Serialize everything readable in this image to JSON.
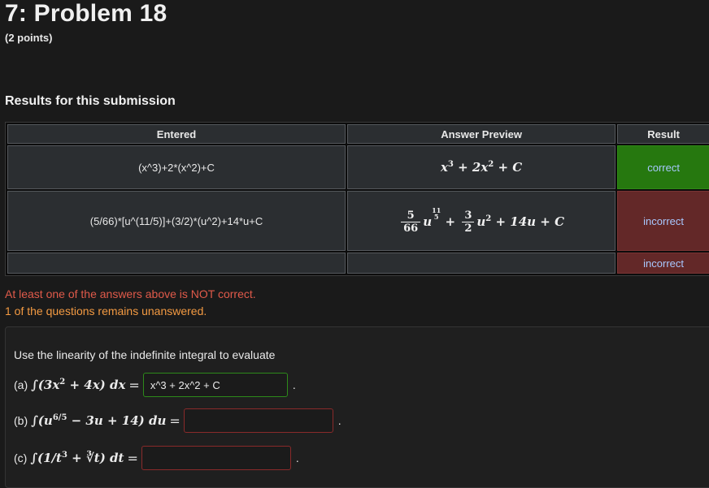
{
  "header": {
    "title": "7: Problem 18",
    "points": "(2 points)"
  },
  "results": {
    "heading": "Results for this submission",
    "columns": [
      "Entered",
      "Answer Preview",
      "Result"
    ],
    "rows": [
      {
        "entered": "(x^3)+2*(x^2)+C",
        "result": "correct"
      },
      {
        "entered": "(5/66)*[u^(11/5)]+(3/2)*(u^2)+14*u+C",
        "result": "incorrect"
      },
      {
        "entered": "",
        "result": "incorrect"
      }
    ],
    "preview1": {
      "a": "x",
      "e1": "3",
      "plus1": "+ 2",
      "b": "x",
      "e2": "2",
      "tail": "+ C"
    },
    "preview2": {
      "num1": "5",
      "den1": "66",
      "u1": "u",
      "en": "11",
      "ed": "5",
      "plus1": "+",
      "num2": "3",
      "den2": "2",
      "u2": "u",
      "e2": "2",
      "tail": "+ 14u + C"
    }
  },
  "messages": {
    "error": "At least one of the answers above is NOT correct.",
    "warning": "1 of the questions remains unanswered."
  },
  "problem": {
    "instructions": "Use the linearity of the indefinite integral to evaluate",
    "parts": [
      {
        "label": "(a)",
        "expr_pre": "∫(3x",
        "expr_exp": "2",
        "expr_post": " + 4x) dx",
        "eq": "=",
        "value": "x^3 + 2x^2 + C",
        "status": "correct"
      },
      {
        "label": "(b)",
        "expr_pre": "∫(u",
        "expr_exp": "6/5",
        "expr_post": " − 3u + 14) du",
        "eq": "=",
        "value": "",
        "status": "incorrect"
      },
      {
        "label": "(c)",
        "expr_pre": "∫(1/t",
        "expr_exp": "3",
        "expr_post": " + ∛t) dt",
        "eq": "=",
        "value": "",
        "status": "incorrect"
      }
    ],
    "dot": "."
  },
  "colors": {
    "correct": "#26780f",
    "incorrect": "#632828",
    "error_text": "#e05a4a",
    "warning_text": "#f39a42",
    "result_text": "#a8c8ff"
  }
}
